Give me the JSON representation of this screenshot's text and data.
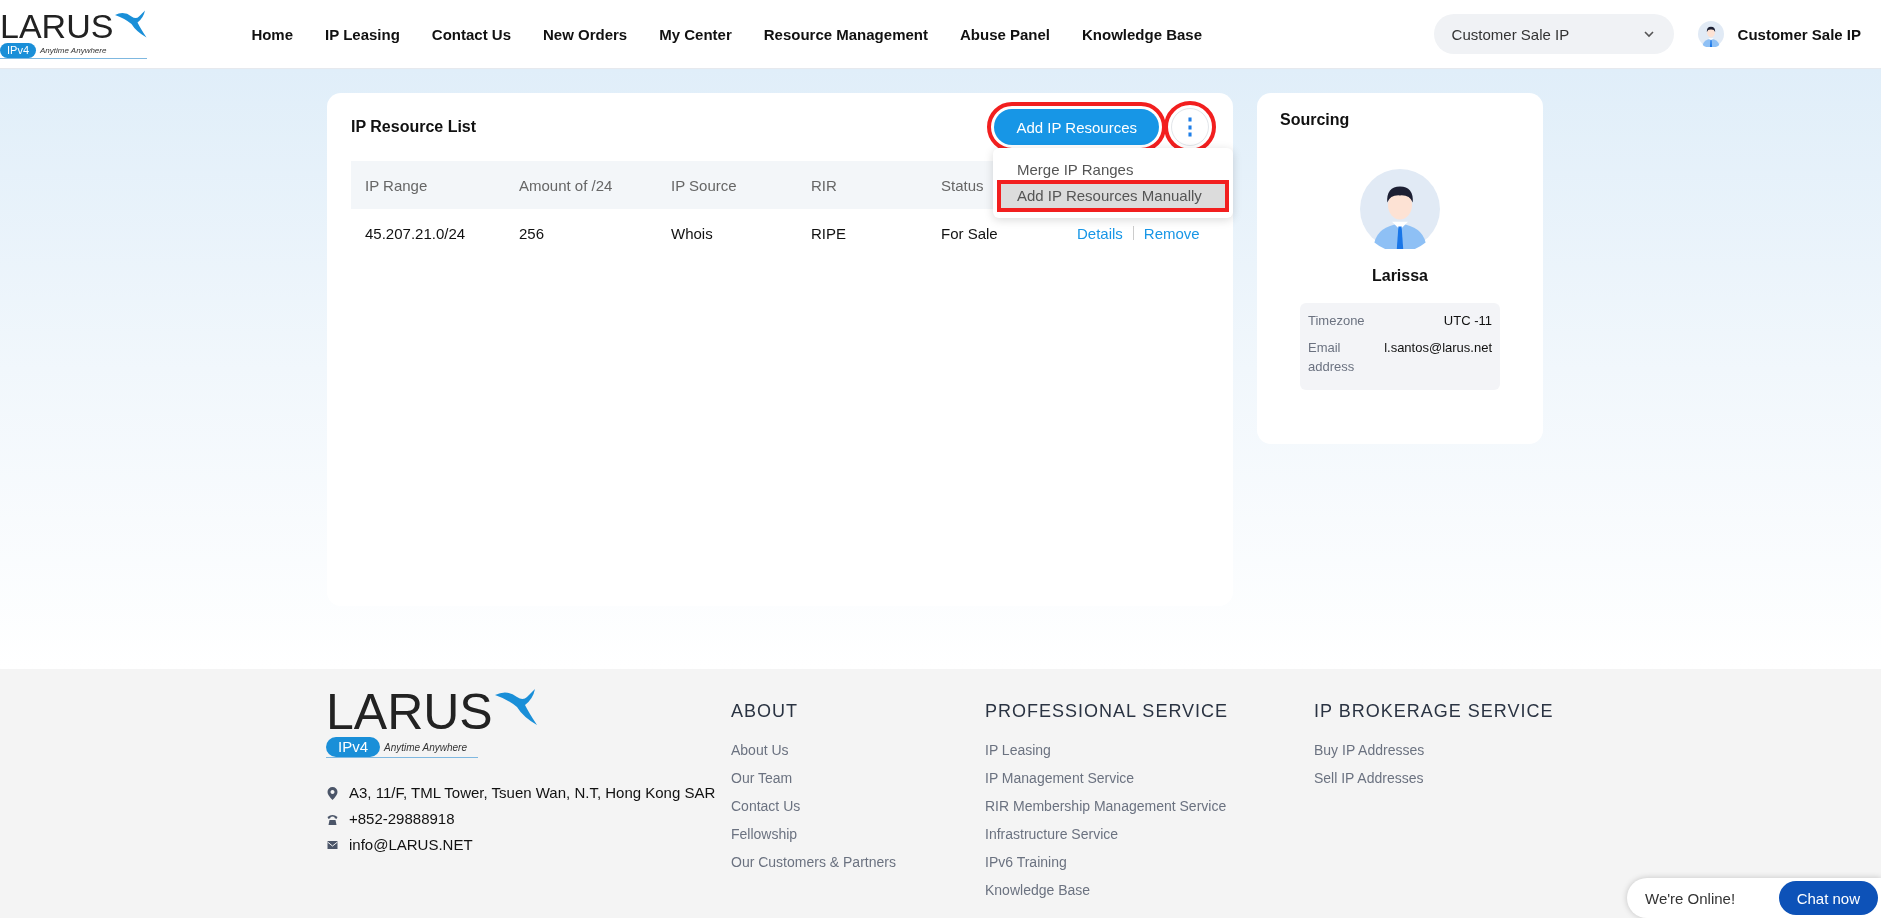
{
  "header": {
    "logo": {
      "name": "LARUS",
      "badge": "IPv4",
      "tagline": "Anytime Anywhere"
    },
    "nav": [
      {
        "label": "Home"
      },
      {
        "label": "IP Leasing"
      },
      {
        "label": "Contact Us"
      },
      {
        "label": "New Orders"
      },
      {
        "label": "My Center"
      },
      {
        "label": "Resource Management"
      },
      {
        "label": "Abuse Panel"
      },
      {
        "label": "Knowledge Base"
      }
    ],
    "account_select": {
      "value": "Customer Sale IP"
    },
    "user": {
      "name": "Customer Sale IP"
    }
  },
  "resource_list": {
    "title": "IP Resource List",
    "add_button": {
      "label": "Add IP Resources",
      "highlighted": true
    },
    "more_button": {
      "label": "⋮",
      "highlighted": true
    },
    "menu": [
      {
        "label": "Merge IP Ranges",
        "hovered": false,
        "highlighted": false
      },
      {
        "label": "Add IP Resources Manually",
        "hovered": true,
        "highlighted": true
      }
    ],
    "table": {
      "columns": [
        "IP Range",
        "Amount of /24",
        "IP Source",
        "RIR",
        "Status"
      ],
      "rows": [
        {
          "cells": [
            "45.207.21.0/24",
            "256",
            "Whois",
            "RIPE",
            "For Sale"
          ],
          "actions": [
            "Details",
            "Remove"
          ]
        }
      ]
    }
  },
  "sourcing": {
    "title": "Sourcing",
    "name": "Larissa",
    "fields": [
      {
        "label": "Timezone",
        "value": "UTC -11"
      },
      {
        "label": "Email address",
        "value": "l.santos@larus.net"
      }
    ]
  },
  "footer": {
    "logo": {
      "name": "LARUS",
      "badge": "IPv4",
      "tagline": "Anytime Anywhere"
    },
    "contacts": [
      {
        "kind": "address",
        "text": "A3, 11/F, TML Tower, Tsuen Wan, N.T, Hong Kong SAR"
      },
      {
        "kind": "phone",
        "text": "+852-29888918"
      },
      {
        "kind": "email",
        "text": "info@LARUS.NET"
      }
    ],
    "columns": [
      {
        "title": "ABOUT",
        "links": [
          "About Us",
          "Our Team",
          "Contact Us",
          "Fellowship",
          "Our Customers & Partners"
        ]
      },
      {
        "title": "PROFESSIONAL SERVICE",
        "links": [
          "IP Leasing",
          "IP Management Service",
          "RIR Membership Management Service",
          "Infrastructure Service",
          "IPv6 Training",
          "Knowledge Base"
        ]
      },
      {
        "title": "IP BROKERAGE SERVICE",
        "links": [
          "Buy IP Addresses",
          "Sell IP Addresses"
        ]
      }
    ]
  },
  "chat": {
    "status": "We're Online!",
    "button": "Chat now"
  }
}
